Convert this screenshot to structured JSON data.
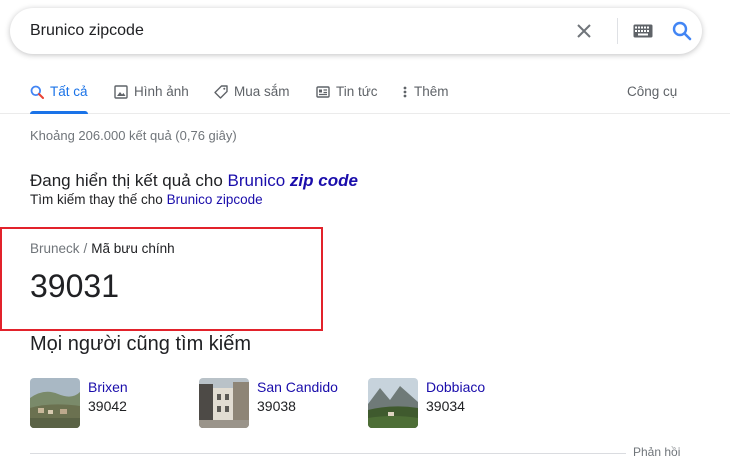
{
  "search": {
    "query": "Brunico zipcode",
    "clear_icon": "close-icon",
    "keyboard_icon": "keyboard-icon",
    "search_icon": "search-icon"
  },
  "tabs": [
    {
      "label": "Tất cả",
      "icon": "search-icon",
      "active": true
    },
    {
      "label": "Hình ảnh",
      "icon": "image-icon",
      "active": false
    },
    {
      "label": "Mua sắm",
      "icon": "tag-icon",
      "active": false
    },
    {
      "label": "Tin tức",
      "icon": "news-icon",
      "active": false
    },
    {
      "label": "Thêm",
      "icon": "more-vert-icon",
      "active": false
    }
  ],
  "tools_label": "Công cụ",
  "result_stats": "Khoảng 206.000 kết quả (0,76 giây)",
  "spelling": {
    "prefix": "Đang hiển thị kết quả cho",
    "corrected_plain": "Brunico",
    "corrected_bold": "zip code",
    "alt_prefix": "Tìm kiếm thay thế cho",
    "alt_query": "Brunico zipcode"
  },
  "answer": {
    "crumb_place": "Bruneck",
    "crumb_separator": "/",
    "crumb_label": "Mã bưu chính",
    "value": "39031"
  },
  "people_also_search": {
    "title": "Mọi người cũng tìm kiếm",
    "items": [
      {
        "name": "Brixen",
        "code": "39042"
      },
      {
        "name": "San Candido",
        "code": "39038"
      },
      {
        "name": "Dobbiaco",
        "code": "39034"
      }
    ]
  },
  "feedback_label": "Phản hồi",
  "colors": {
    "accent": "#1a73e8",
    "link": "#1a0dab",
    "highlight_border": "#e2222b"
  }
}
